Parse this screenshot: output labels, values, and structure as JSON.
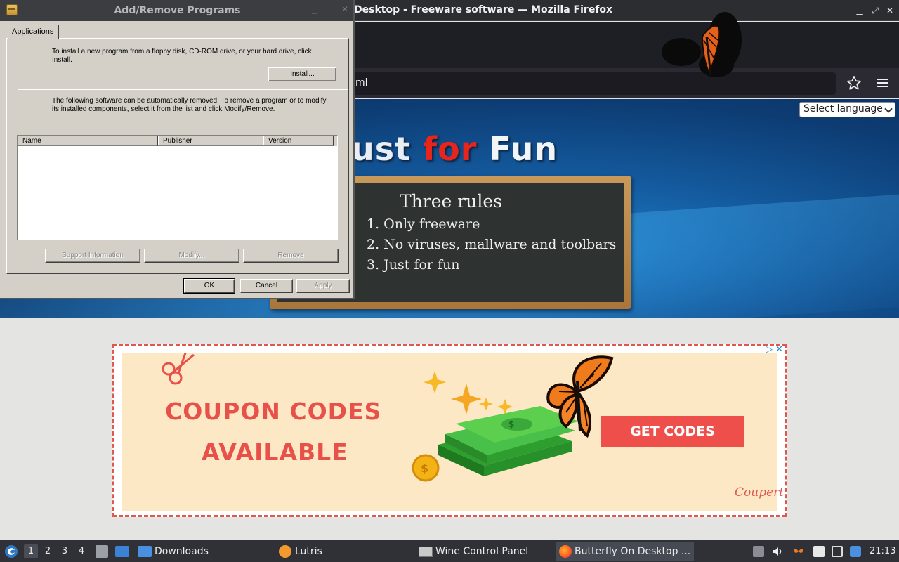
{
  "firefox": {
    "window_title": "Desktop - Freeware software — Mozilla Firefox",
    "url_fragment": "ml",
    "language_select": "Select language"
  },
  "hero": {
    "title_part1": "ust ",
    "title_part2": "for",
    "title_part3": " Fun",
    "board_title": "Three rules",
    "rules": [
      "1. Only freeware",
      "2. No viruses, mallware and toolbars",
      "3. Just for fun"
    ]
  },
  "ad": {
    "line1": "COUPON CODES",
    "line2": "AVAILABLE",
    "cta": "GET CODES",
    "brand": "Coupert",
    "adchoices": "▷ ✕"
  },
  "dialog": {
    "title": "Add/Remove Programs",
    "tab": "Applications",
    "install_text": "To install a new program from a floppy disk, CD-ROM drive, or your hard drive, click Install.",
    "install_button": "Install...",
    "remove_text": "The following software can be automatically removed. To remove a program or to modify its installed components, select it from the list and click Modify/Remove.",
    "columns": [
      "Name",
      "Publisher",
      "Version"
    ],
    "support_button": "Support Information",
    "modify_button": "Modify...",
    "remove_button": "Remove",
    "ok_button": "OK",
    "cancel_button": "Cancel",
    "apply_button": "Apply"
  },
  "taskbar": {
    "workspaces": [
      "1",
      "2",
      "3",
      "4"
    ],
    "tasks": [
      {
        "label": "Downloads"
      },
      {
        "label": "Lutris"
      },
      {
        "label": "Wine Control Panel"
      },
      {
        "label": "Butterfly On Desktop ..."
      }
    ],
    "clock": "21:13"
  },
  "colors": {
    "accent_red": "#e8504a",
    "hero_blue": "#145a9e",
    "dialog_gray": "#d4d0c8"
  }
}
